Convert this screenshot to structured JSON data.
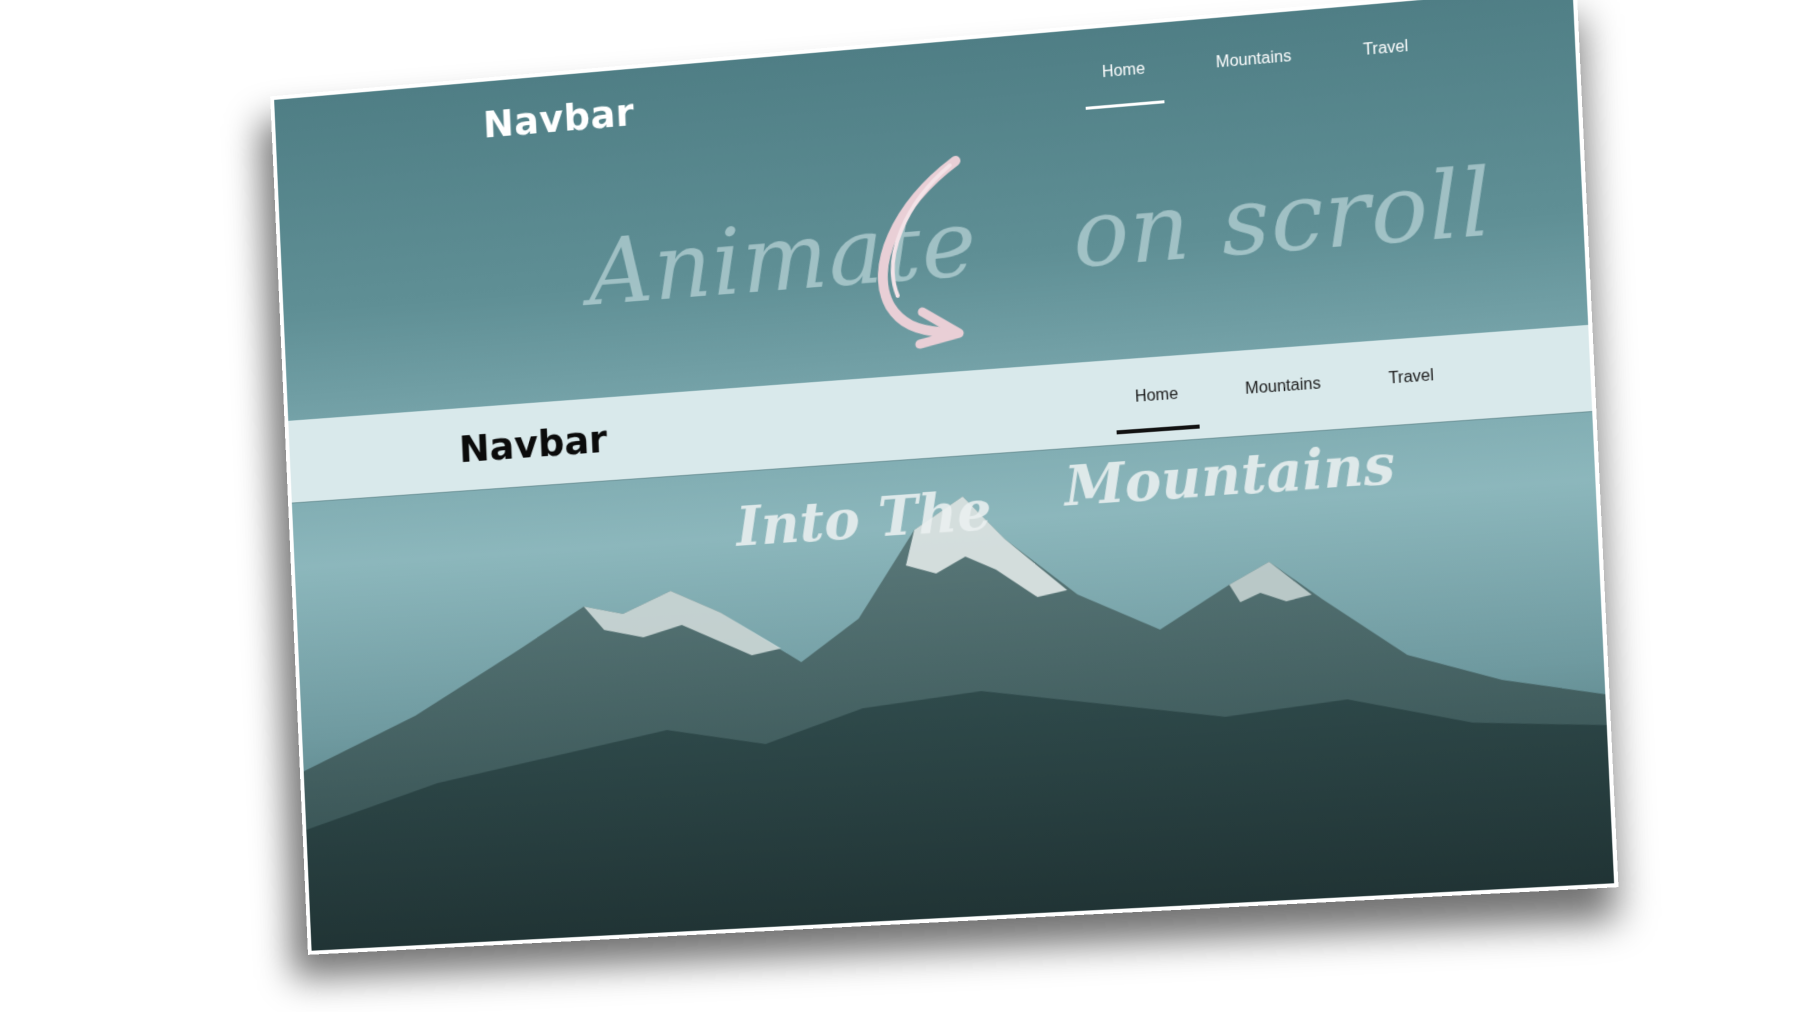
{
  "navbar_top": {
    "brand": "Navbar",
    "links": [
      "Home",
      "Mountains",
      "Travel"
    ],
    "active": "Home"
  },
  "headline": {
    "left": "Animate",
    "right": "on scroll"
  },
  "navbar_sticky": {
    "brand": "Navbar",
    "links": [
      "Home",
      "Mountains",
      "Travel"
    ],
    "active": "Home"
  },
  "hero": {
    "title_left": "Into The",
    "title_right": "Mountains"
  },
  "colors": {
    "sky_top": "#4f7e85",
    "sky_mid": "#8cb7bc",
    "sticky_bar": "#d9e9eb",
    "arrow": "#e9cfd6"
  }
}
